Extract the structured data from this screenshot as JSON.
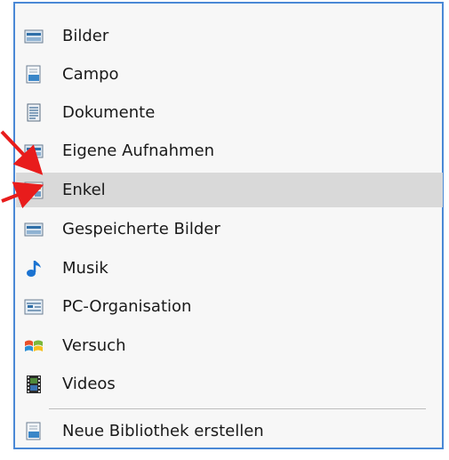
{
  "menu": {
    "items": [
      {
        "label": "Bilder",
        "icon": "library-pictures-icon"
      },
      {
        "label": "Campo",
        "icon": "library-document-icon"
      },
      {
        "label": "Dokumente",
        "icon": "library-documents-icon"
      },
      {
        "label": "Eigene Aufnahmen",
        "icon": "library-pictures-icon"
      },
      {
        "label": "Enkel",
        "icon": "library-grid-icon",
        "highlighted": true
      },
      {
        "label": "Gespeicherte Bilder",
        "icon": "library-pictures-icon"
      },
      {
        "label": "Musik",
        "icon": "music-note-icon"
      },
      {
        "label": "PC-Organisation",
        "icon": "library-organize-icon"
      },
      {
        "label": "Versuch",
        "icon": "windows-logo-icon"
      },
      {
        "label": "Videos",
        "icon": "video-film-icon"
      }
    ],
    "footer_item": {
      "label": "Neue Bibliothek erstellen",
      "icon": "new-library-icon"
    }
  },
  "annotation": {
    "arrow_color": "#e81c1c",
    "menu_border_color": "#4a88d6",
    "highlight_color": "#d9d9d9"
  }
}
